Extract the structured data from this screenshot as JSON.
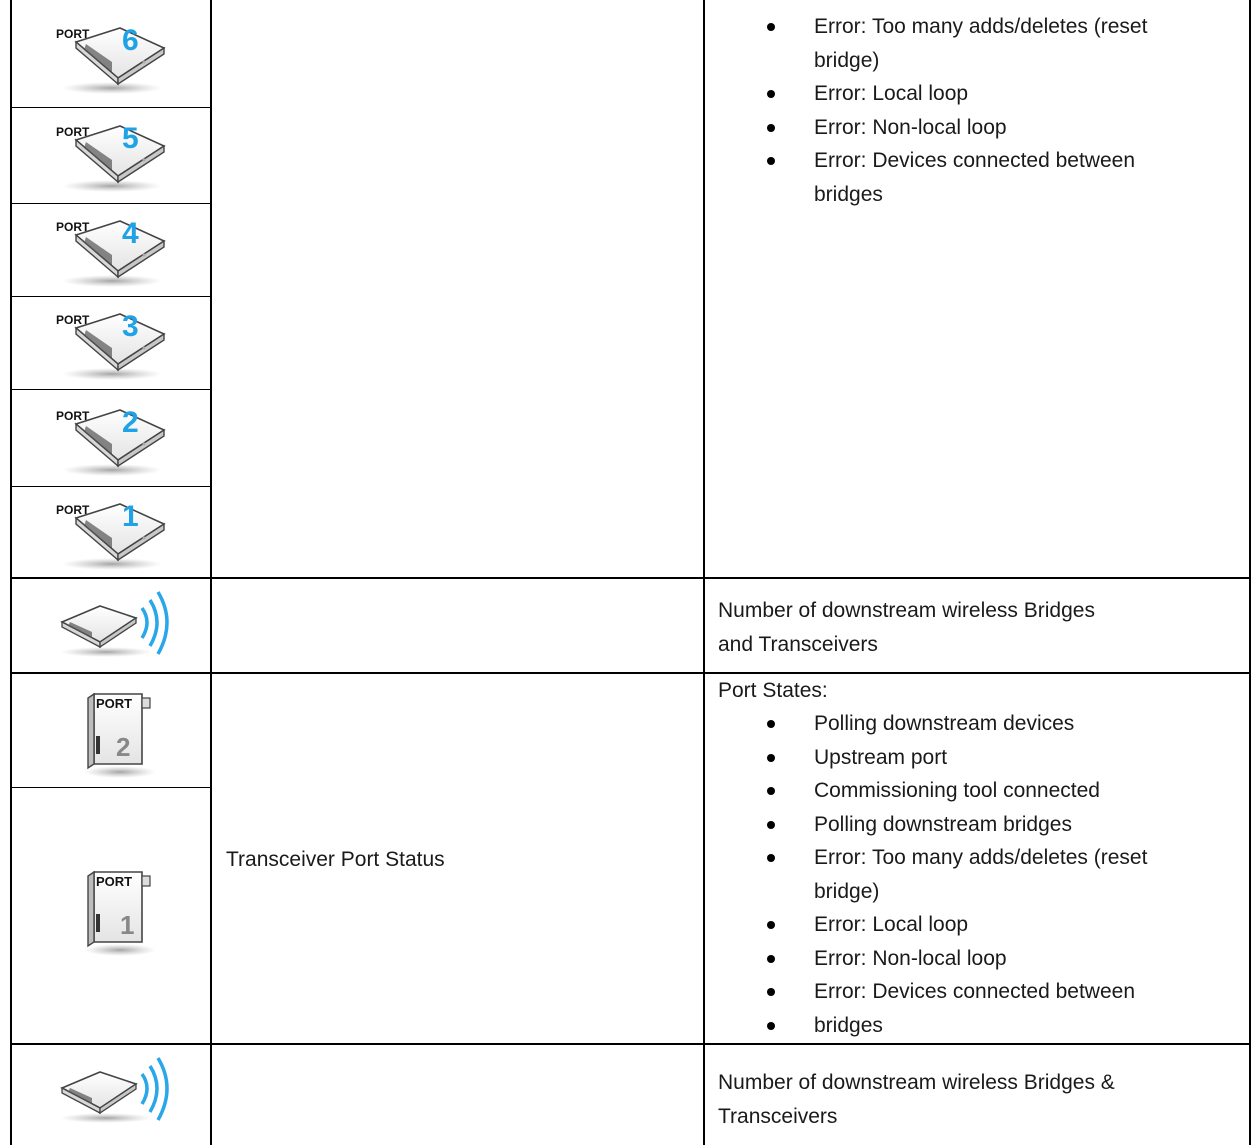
{
  "icons": {
    "port6": "bridge-port-6-icon",
    "port5": "bridge-port-5-icon",
    "port4": "bridge-port-4-icon",
    "port3": "bridge-port-3-icon",
    "port2": "bridge-port-2-icon",
    "port1": "bridge-port-1-icon",
    "wireless1": "wireless-bridge-icon",
    "tport2": "transceiver-port-2-icon",
    "tport1": "transceiver-port-1-icon",
    "wireless2": "wireless-transceiver-icon",
    "port_word": "PORT",
    "n6": "6",
    "n5": "5",
    "n4": "4",
    "n3": "3",
    "n2": "2",
    "n1": "1"
  },
  "colors": {
    "port_number_blue": "#1fa3e6",
    "wave_blue": "#2aa6ea"
  },
  "section1": {
    "items": [
      "Error: Too many adds/deletes (reset",
      "bridge)",
      "Error: Local loop",
      "Error: Non-local loop",
      "Error: Devices connected between",
      "bridges"
    ]
  },
  "section2": {
    "line1": "Number of downstream wireless Bridges",
    "line2": "and Transceivers"
  },
  "section3": {
    "label": "Transceiver Port Status",
    "heading": "Port States:",
    "items": [
      "Polling downstream devices",
      "Upstream port",
      "Commissioning tool connected",
      "Polling downstream bridges",
      "Error: Too many adds/deletes (reset",
      "bridge)",
      "Error: Local loop",
      "Error: Non-local loop",
      "Error: Devices connected between",
      "bridges"
    ]
  },
  "section4": {
    "line1": "Number of downstream wireless Bridges &",
    "line2": "Transceivers"
  }
}
